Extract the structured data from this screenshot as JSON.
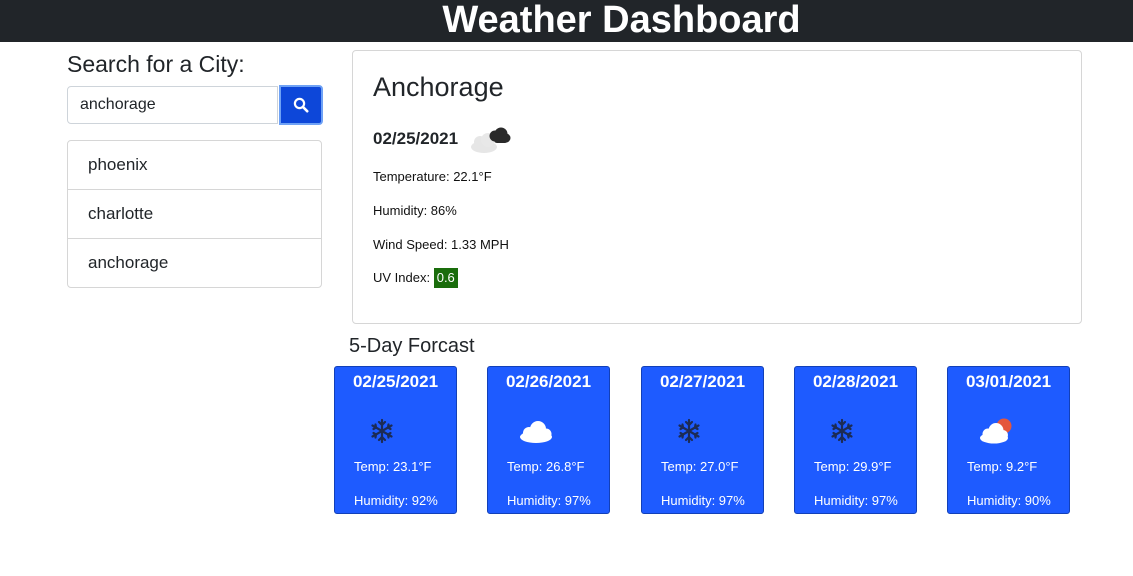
{
  "header": {
    "title": "Weather Dashboard"
  },
  "search": {
    "heading": "Search for a City:",
    "value": "anchorage",
    "button_icon": "search-icon"
  },
  "history": [
    "phoenix",
    "charlotte",
    "anchorage"
  ],
  "current": {
    "city": "Anchorage",
    "date": "02/25/2021",
    "icon": "dark-clouds-icon",
    "temperature": "Temperature: 22.1°F",
    "humidity": "Humidity: 86%",
    "wind": "Wind Speed: 1.33 MPH",
    "uv_label": "UV Index:",
    "uv_value": "0.6",
    "uv_color": "#1a6d0c"
  },
  "forecast": {
    "heading": "5-Day Forcast",
    "card_color": "#1e5bff",
    "days": [
      {
        "date": "02/25/2021",
        "icon": "snowflake-icon",
        "temp": "Temp: 23.1°F",
        "humidity": "Humidity: 92%"
      },
      {
        "date": "02/26/2021",
        "icon": "cloud-icon",
        "temp": "Temp: 26.8°F",
        "humidity": "Humidity: 97%"
      },
      {
        "date": "02/27/2021",
        "icon": "snowflake-icon",
        "temp": "Temp: 27.0°F",
        "humidity": "Humidity: 97%"
      },
      {
        "date": "02/28/2021",
        "icon": "snowflake-icon",
        "temp": "Temp: 29.9°F",
        "humidity": "Humidity: 97%"
      },
      {
        "date": "03/01/2021",
        "icon": "partly-cloudy-icon",
        "temp": "Temp: 9.2°F",
        "humidity": "Humidity: 90%"
      }
    ]
  }
}
